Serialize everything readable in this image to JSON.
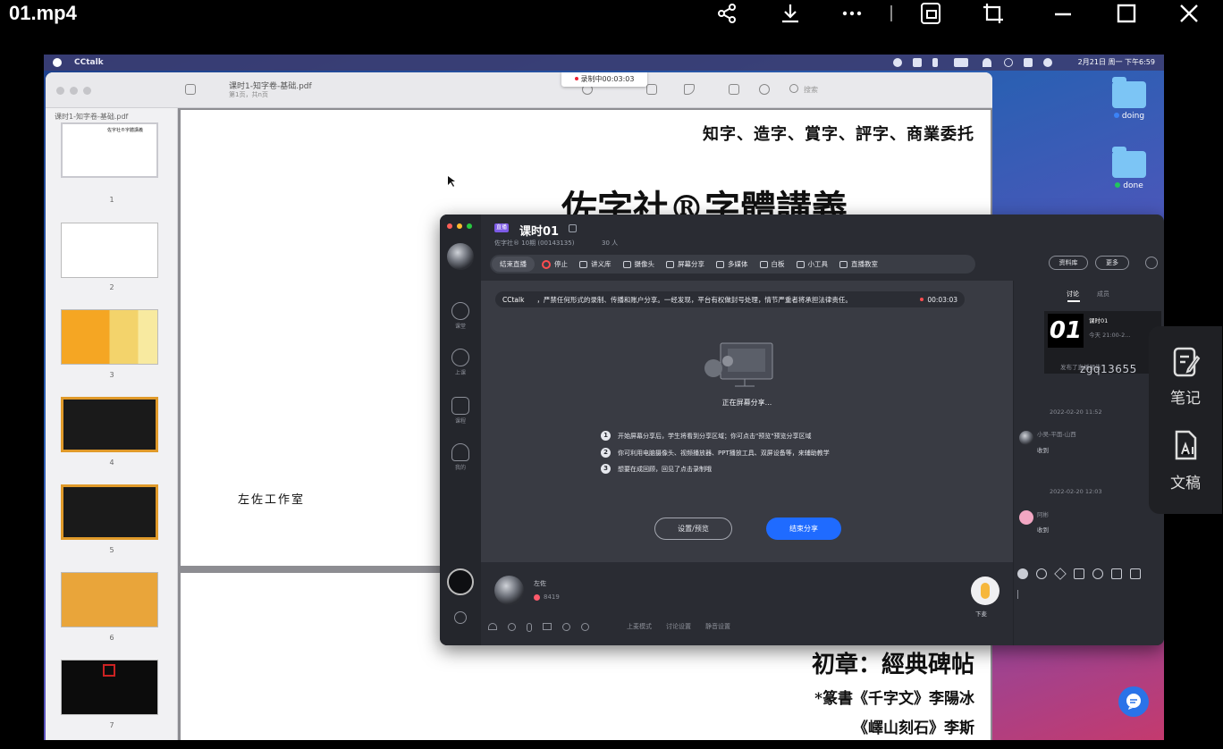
{
  "player": {
    "title": "01.mp4",
    "icons": [
      "share-icon",
      "download-icon",
      "more-icon",
      "picture-in-picture-icon",
      "crop-icon",
      "minimize-icon",
      "maximize-icon",
      "close-icon"
    ]
  },
  "mac": {
    "app_name": "CCtalk",
    "clock": "2月21日 周一 下午6:59",
    "desktop_folders": [
      {
        "label": "doing",
        "dot_color": "#3b82f6"
      },
      {
        "label": "done",
        "dot_color": "#22c55e"
      }
    ]
  },
  "pdf": {
    "filename": "课时1-知字卷-基础.pdf",
    "subtitle": "第1页，共n页",
    "sidebar_title": "课时1-知字卷-基础.pdf",
    "search_placeholder": "搜索",
    "recording": "录制中00:03:03",
    "thumb_numbers": [
      "1",
      "2",
      "3",
      "4",
      "5",
      "6",
      "7"
    ],
    "page1_header": "知字、造字、賞字、評字、商業委托",
    "page1_title": "佐字社®字體講義",
    "page1_studio": "左佐工作室",
    "page2_chapter": "初章：經典碑帖",
    "page2_line1": "*篆書《千字文》李陽冰",
    "page2_line2": "《嶧山刻石》李斯"
  },
  "cctalk": {
    "badge": "直播",
    "title": "课时01",
    "subtitle": "佐字社® 10期 (00143135)",
    "members": "30 人",
    "toolbar": [
      "结束直播",
      "停止",
      "讲义库",
      "摄像头",
      "屏幕分享",
      "多媒体",
      "白板",
      "小工具",
      "直播教室"
    ],
    "right_buttons": [
      "资料库",
      "更多"
    ],
    "rail": [
      "课堂",
      "上课",
      "课程",
      "我的"
    ],
    "notice_brand": "CCtalk",
    "notice_text": "，严禁任何形式的录制、传播和账户分享。一经发现，平台有权做封号处理，情节严重者将承担法律责任。",
    "notice_timer": "00:03:03",
    "sharing_title": "正在屏幕分享...",
    "steps": [
      {
        "n": "1",
        "text": "开始屏幕分享后，学生将看到分享区域；你可点击\"预览\"预览分享区域"
      },
      {
        "n": "2",
        "text": "你可利用电脑摄像头、视频播放器、PPT播放工具、双屏设备等，来辅助教学"
      },
      {
        "n": "3",
        "text": "想要在成回顾，回见了点击录制哦"
      }
    ],
    "btn_settings": "设置/预览",
    "btn_end": "结束分享",
    "speaker_name": "左佐",
    "speaker_likes": "8419",
    "raise_hand": "下麦",
    "bottom_bar": [
      "上麦模式",
      "讨论设置",
      "静音设置"
    ],
    "chat_tabs": [
      "讨论",
      "成员"
    ],
    "announce_big": "01",
    "announce_title": "课时01",
    "announce_time": "今天 21:00-2...",
    "announce_note": "发布了直播预告",
    "watermark": "zgq13655",
    "messages": [
      {
        "time": "2022-02-20 11:52",
        "name": "小吴-平面-山西",
        "text": "收到"
      },
      {
        "time": "2022-02-20 12:03",
        "name": "阿彬",
        "text": "收到"
      }
    ]
  },
  "floating_panel": {
    "items": [
      {
        "label": "笔记",
        "icon": "note-icon"
      },
      {
        "label": "文稿",
        "icon": "transcript-icon"
      }
    ]
  }
}
